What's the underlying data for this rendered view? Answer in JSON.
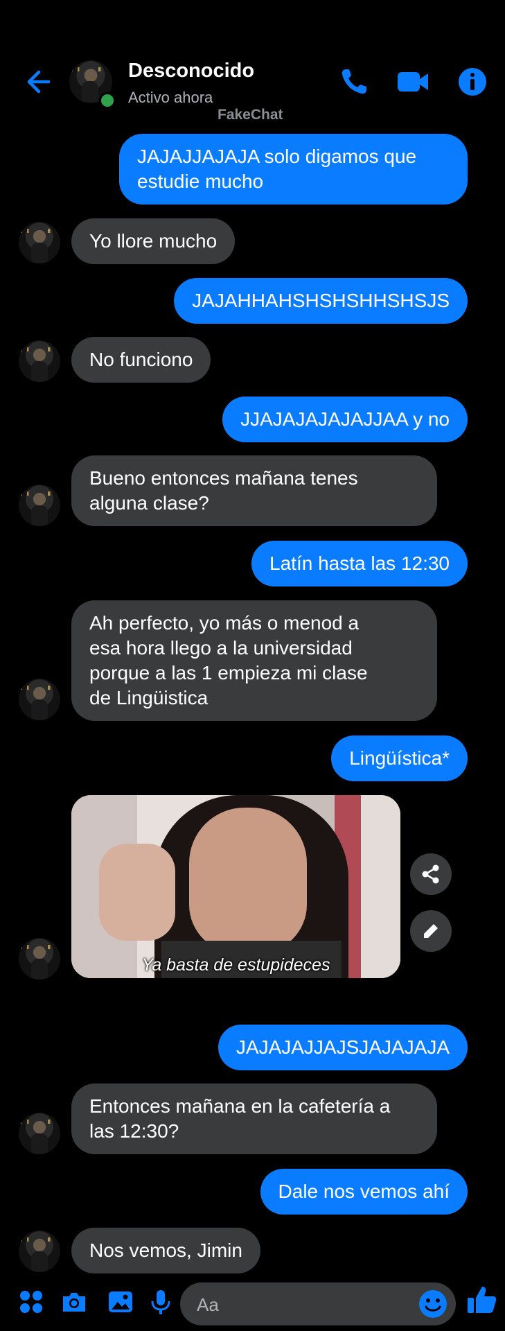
{
  "header": {
    "contact_name": "Desconocido",
    "status": "Activo ahora",
    "watermark": "FakeChat"
  },
  "colors": {
    "accent": "#0a7cff",
    "incoming_bubble": "#3a3b3c",
    "online": "#31a24c",
    "background": "#000000"
  },
  "icons": [
    "back-arrow-icon",
    "phone-icon",
    "video-icon",
    "info-icon",
    "share-icon",
    "edit-icon",
    "apps-icon",
    "camera-icon",
    "gallery-icon",
    "mic-icon",
    "emoji-icon",
    "thumbs-up-icon"
  ],
  "messages": [
    {
      "from": "me",
      "text": "JAJAJJAJAJA solo digamos que\nestudie mucho"
    },
    {
      "from": "them",
      "text": "Yo llore mucho"
    },
    {
      "from": "me",
      "text": "JAJAHHAHSHSHSHHSHSJS"
    },
    {
      "from": "them",
      "text": "No funciono"
    },
    {
      "from": "me",
      "text": "JJAJAJAJAJAJJAA y no"
    },
    {
      "from": "them",
      "text": "Bueno entonces mañana tenes\nalguna clase?"
    },
    {
      "from": "me",
      "text": "Latín hasta las 12:30"
    },
    {
      "from": "them",
      "text": "Ah perfecto, yo más o menod a\nesa hora llego a la universidad\nporque a las 1 empieza mi clase\nde Lingüistica"
    },
    {
      "from": "me",
      "text": "Lingüística*"
    },
    {
      "from": "them",
      "type": "gif",
      "caption": "Ya basta de estupideces"
    },
    {
      "from": "me",
      "text": "JAJAJAJJAJSJAJAJAJA"
    },
    {
      "from": "them",
      "text": "Entonces mañana en la cafetería a\nlas 12:30?"
    },
    {
      "from": "me",
      "text": "Dale nos vemos ahí"
    },
    {
      "from": "them",
      "text": "Nos vemos, Jimin"
    }
  ],
  "composer": {
    "placeholder": "Aa"
  }
}
